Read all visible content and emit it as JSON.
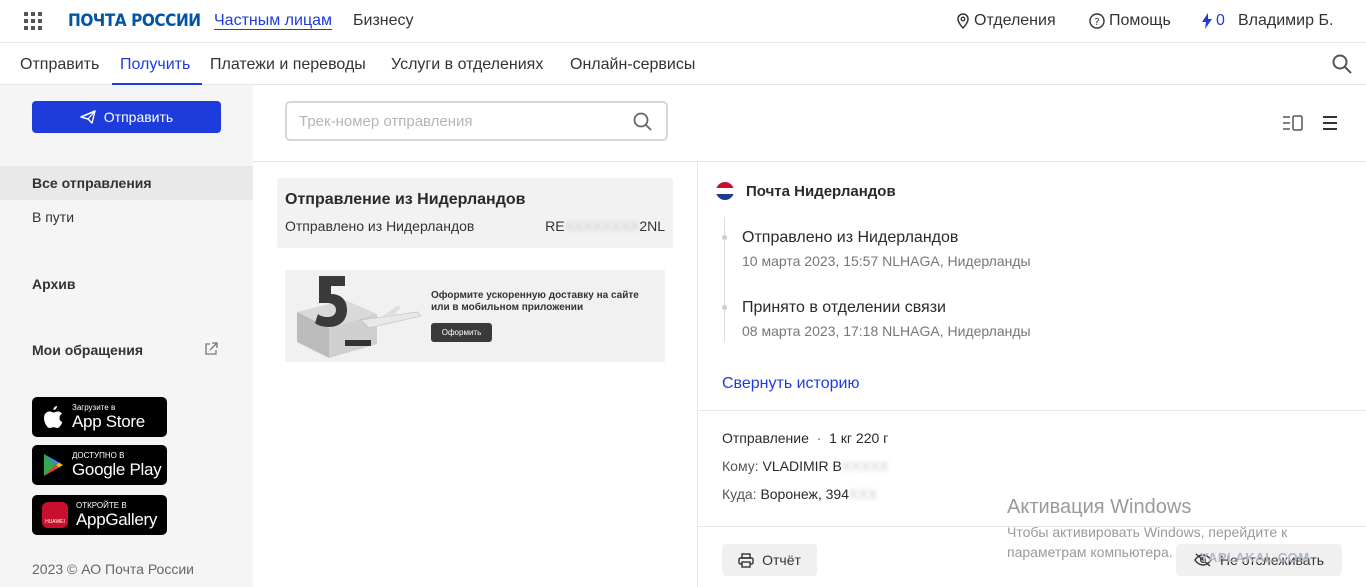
{
  "header": {
    "logo": "ПОЧТА РОССИИ",
    "links": [
      "Частным лицам",
      "Бизнесу"
    ],
    "offices": "Отделения",
    "help": "Помощь",
    "bonus": "0",
    "user": "Владимир Б."
  },
  "nav": {
    "items": [
      "Отправить",
      "Получить",
      "Платежи и переводы",
      "Услуги в отделениях",
      "Онлайн-сервисы"
    ],
    "active": "Получить"
  },
  "sidebar": {
    "send_button": "Отправить",
    "items": [
      "Все отправления",
      "В пути"
    ],
    "archive": "Архив",
    "appeals": "Мои обращения",
    "stores": [
      {
        "small": "Загрузите в",
        "big": "App Store"
      },
      {
        "small": "ДОСТУПНО В",
        "big": "Google Play"
      },
      {
        "small": "ОТКРОЙТЕ В",
        "big": "AppGallery"
      }
    ],
    "huawei_label": "HUAWEI",
    "copyright": "2023 © АО Почта России"
  },
  "search": {
    "placeholder": "Трек-номер отправления"
  },
  "shipment_card": {
    "title": "Отправление из Нидерландов",
    "status": "Отправлено из Нидерландов",
    "track_prefix": "RE",
    "track_hidden": "XXXXXXXX",
    "track_suffix": "2NL"
  },
  "promo": {
    "text": "Оформите ускоренную доставку на сайте или в мобильном приложении",
    "button": "Оформить"
  },
  "detail": {
    "carrier": "Почта Нидерландов",
    "events": [
      {
        "title": "Отправлено из Нидерландов",
        "sub": "10 марта 2023, 15:57 NLHAGA, Нидерланды"
      },
      {
        "title": "Принято в отделении связи",
        "sub": "08 марта 2023, 17:18 NLHAGA, Нидерланды"
      }
    ],
    "collapse": "Свернуть историю",
    "shipment_label": "Отправление",
    "weight": "1 кг 220 г",
    "to_label": "Кому:",
    "to_value": "VLADIMIR B",
    "to_hidden": "XXXXX",
    "where_label": "Куда:",
    "where_value": "Воронеж, 394",
    "where_hidden": "XXX",
    "print": "Отчёт",
    "untrack": "Не отслеживать"
  },
  "watermark": {
    "line1": "Активация Windows",
    "line2": "Чтобы активировать Windows, перейдите к",
    "line3": "параметрам компьютера."
  },
  "site_watermark": "YAPLAKAL.COM",
  "colors": {
    "accent": "#1e3cdc",
    "logo": "#0055a5",
    "sidebar_bg": "#f5f5f5"
  }
}
